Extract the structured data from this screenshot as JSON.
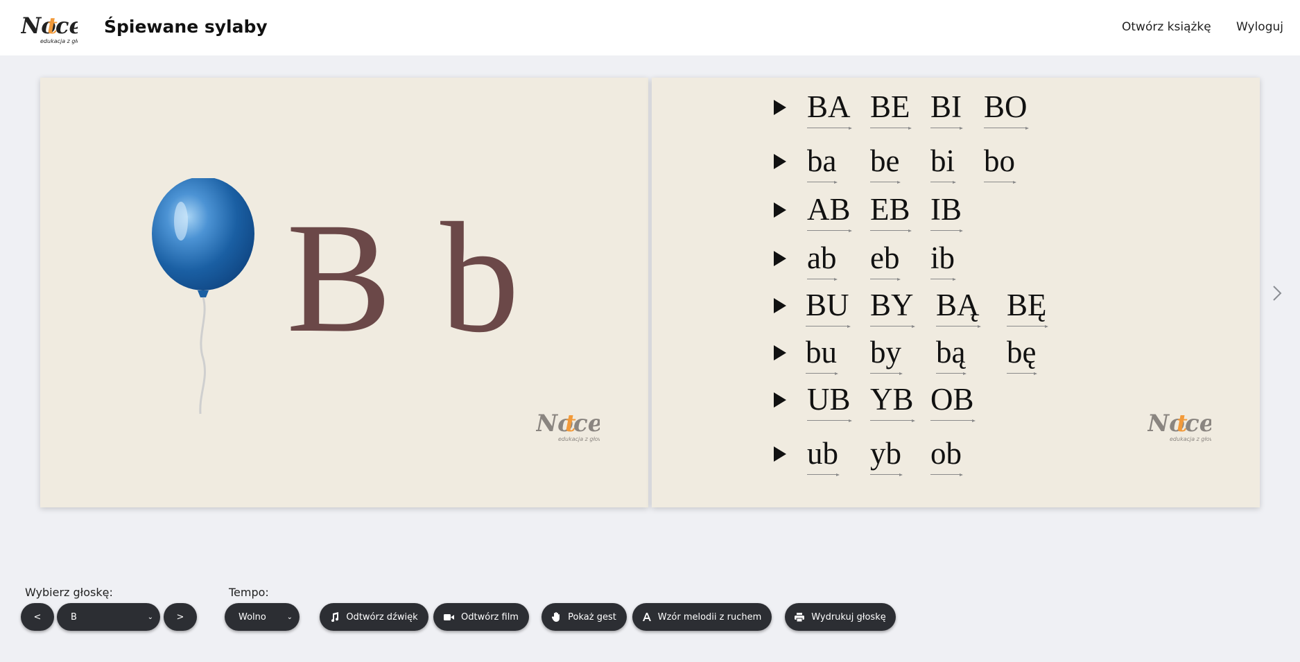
{
  "header": {
    "logo_text": "Notice",
    "logo_tagline": "edukacja z głową",
    "title": "Śpiewane sylaby",
    "nav": {
      "open_book": "Otwórz książkę",
      "logout": "Wyloguj"
    }
  },
  "left_page": {
    "upper": "B",
    "lower": "b",
    "image": "blue-balloon",
    "letter_color": "#6b4848"
  },
  "right_page": {
    "rows": [
      [
        "BA",
        "BE",
        "BI",
        "BO"
      ],
      [
        "ba",
        "be",
        "bi",
        "bo"
      ],
      [
        "AB",
        "EB",
        "IB"
      ],
      [
        "ab",
        "eb",
        "ib"
      ],
      [
        "BU",
        "BY",
        "BĄ",
        "BĘ"
      ],
      [
        "bu",
        "by",
        "bą",
        "bę"
      ],
      [
        "UB",
        "YB",
        "OB"
      ],
      [
        "ub",
        "yb",
        "ob"
      ]
    ]
  },
  "controls": {
    "sound_label": "Wybierz głoskę:",
    "prev_label": "<",
    "next_label": ">",
    "sound_selected": "B",
    "tempo_label": "Tempo:",
    "tempo_selected": "Wolno",
    "play_sound": "Odtwórz dźwięk",
    "play_film": "Odtwórz film",
    "show_gesture": "Pokaż gest",
    "melody_pattern": "Wzór melodii z ruchem",
    "print_sound": "Wydrukuj głoskę"
  },
  "colors": {
    "page_bg": "#f0ebe0",
    "button_bg": "#2c2e33",
    "logo_accent": "#f29a3a"
  }
}
